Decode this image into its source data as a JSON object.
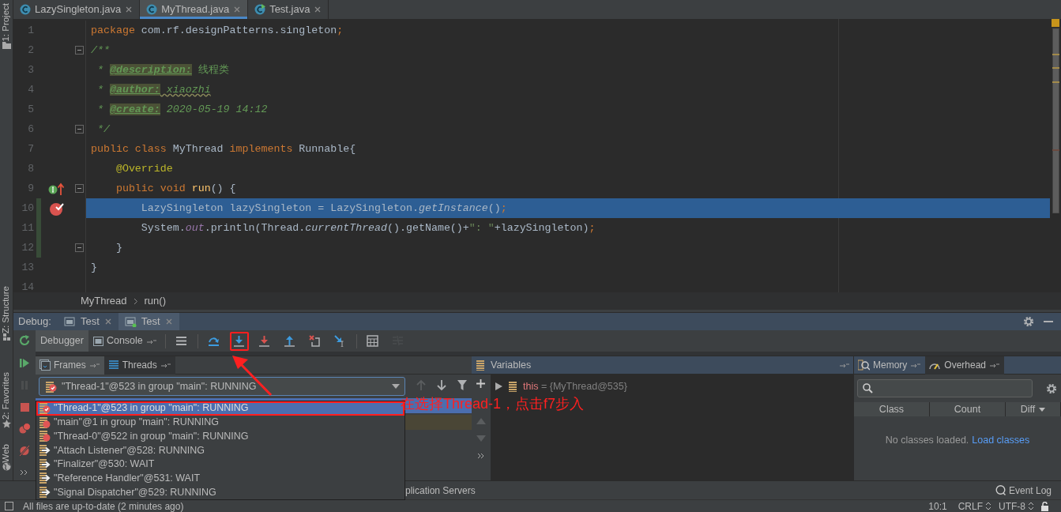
{
  "editor_tabs": [
    {
      "label": "LazySingleton.java",
      "kind": "class",
      "selected": false
    },
    {
      "label": "MyThread.java",
      "kind": "class",
      "selected": true
    },
    {
      "label": "Test.java",
      "kind": "runnable",
      "selected": false
    }
  ],
  "side_tools": [
    "1: Project",
    "Z: Structure",
    "2: Favorites",
    "Web"
  ],
  "code_lines": [
    {
      "number": "1",
      "fold": false,
      "changed": false,
      "override_marker": false,
      "breakpoint": false,
      "selected": false,
      "tokens": [
        {
          "kind": "keyword",
          "text": "package "
        },
        {
          "kind": "plain",
          "text": "com.rf.designPatterns.singleton"
        },
        {
          "kind": "keyword",
          "text": ";"
        }
      ]
    },
    {
      "number": "2",
      "fold": true,
      "changed": false,
      "override_marker": false,
      "breakpoint": false,
      "selected": false,
      "tokens": [
        {
          "kind": "doc",
          "text": "/**"
        }
      ]
    },
    {
      "number": "3",
      "fold": false,
      "changed": false,
      "override_marker": false,
      "breakpoint": false,
      "selected": false,
      "tokens": [
        {
          "kind": "doc",
          "text": " * "
        },
        {
          "kind": "tag",
          "text": "@description:"
        },
        {
          "kind": "docplain",
          "text": " 线程类"
        }
      ]
    },
    {
      "number": "4",
      "fold": false,
      "changed": false,
      "override_marker": false,
      "breakpoint": false,
      "selected": false,
      "tokens": [
        {
          "kind": "doc",
          "text": " * "
        },
        {
          "kind": "tag",
          "text": "@author:"
        },
        {
          "kind": "docvalue",
          "text": " xiaozhi"
        }
      ]
    },
    {
      "number": "5",
      "fold": false,
      "changed": false,
      "override_marker": false,
      "breakpoint": false,
      "selected": false,
      "tokens": [
        {
          "kind": "doc",
          "text": " * "
        },
        {
          "kind": "tag",
          "text": "@create:"
        },
        {
          "kind": "doc",
          "text": " 2020-05-19 14:12"
        }
      ]
    },
    {
      "number": "6",
      "fold": true,
      "changed": false,
      "override_marker": false,
      "breakpoint": false,
      "selected": false,
      "tokens": [
        {
          "kind": "doc",
          "text": " */"
        }
      ]
    },
    {
      "number": "7",
      "fold": false,
      "changed": false,
      "override_marker": false,
      "breakpoint": false,
      "selected": false,
      "tokens": [
        {
          "kind": "keyword",
          "text": "public class "
        },
        {
          "kind": "plain",
          "text": "MyThread "
        },
        {
          "kind": "keyword",
          "text": "implements "
        },
        {
          "kind": "plain",
          "text": "Runnable{"
        }
      ]
    },
    {
      "number": "8",
      "fold": false,
      "changed": false,
      "override_marker": false,
      "breakpoint": false,
      "selected": false,
      "tokens": [
        {
          "kind": "annotation",
          "text": "    @Override"
        }
      ]
    },
    {
      "number": "9",
      "fold": true,
      "changed": false,
      "override_marker": true,
      "breakpoint": false,
      "selected": false,
      "tokens": [
        {
          "kind": "keyword",
          "text": "    public void "
        },
        {
          "kind": "method",
          "text": "run"
        },
        {
          "kind": "plain",
          "text": "() {"
        }
      ]
    },
    {
      "number": "10",
      "fold": false,
      "changed": true,
      "override_marker": false,
      "breakpoint": true,
      "selected": true,
      "tokens": [
        {
          "kind": "plain",
          "text": "        LazySingleton lazySingleton = LazySingleton."
        },
        {
          "kind": "static",
          "text": "getInstance"
        },
        {
          "kind": "plain",
          "text": "()"
        },
        {
          "kind": "keyword",
          "text": ";"
        }
      ]
    },
    {
      "number": "11",
      "fold": false,
      "changed": true,
      "override_marker": false,
      "breakpoint": false,
      "selected": false,
      "tokens": [
        {
          "kind": "plain",
          "text": "        System."
        },
        {
          "kind": "field",
          "text": "out"
        },
        {
          "kind": "plain",
          "text": ".println(Thread."
        },
        {
          "kind": "static",
          "text": "currentThread"
        },
        {
          "kind": "plain",
          "text": "().getName()+"
        },
        {
          "kind": "string",
          "text": "\": \""
        },
        {
          "kind": "plain",
          "text": "+lazySingleton)"
        },
        {
          "kind": "keyword",
          "text": ";"
        }
      ]
    },
    {
      "number": "12",
      "fold": true,
      "changed": true,
      "override_marker": false,
      "breakpoint": false,
      "selected": false,
      "tokens": [
        {
          "kind": "plain",
          "text": "    }"
        }
      ]
    },
    {
      "number": "13",
      "fold": false,
      "changed": false,
      "override_marker": false,
      "breakpoint": false,
      "selected": false,
      "tokens": [
        {
          "kind": "plain",
          "text": "}"
        }
      ]
    },
    {
      "number": "14",
      "fold": false,
      "changed": false,
      "override_marker": false,
      "breakpoint": false,
      "selected": false
    }
  ],
  "breadcrumb": [
    "MyThread",
    "run()"
  ],
  "debug": {
    "title": "Debug:",
    "sessions": [
      {
        "label": "Test",
        "running": false,
        "selected": false
      },
      {
        "label": "Test",
        "running": true,
        "selected": true
      }
    ],
    "side_toolbar": [
      {
        "kind": "rerun",
        "disabled": false
      },
      {
        "kind": "resume",
        "disabled": false
      },
      {
        "kind": "pause",
        "disabled": true
      },
      {
        "kind": "stop",
        "disabled": false
      },
      {
        "kind": "view-breakpoints",
        "disabled": false
      },
      {
        "kind": "mute-breakpoints",
        "disabled": false
      },
      {
        "kind": "more",
        "disabled": false
      }
    ],
    "tabs": [
      {
        "label": "Debugger",
        "selected": true
      },
      {
        "label": "Console",
        "selected": false
      }
    ],
    "toolbar": [
      {
        "kind": "menu",
        "disabled": false,
        "annotated": false
      },
      {
        "kind": "separator"
      },
      {
        "kind": "step-over",
        "disabled": false,
        "annotated": false
      },
      {
        "kind": "step-into",
        "disabled": false,
        "annotated": true
      },
      {
        "kind": "force-step-into",
        "disabled": false,
        "annotated": false
      },
      {
        "kind": "step-out",
        "disabled": false,
        "annotated": false
      },
      {
        "kind": "drop-frame",
        "disabled": false,
        "annotated": false
      },
      {
        "kind": "run-to-cursor",
        "disabled": false,
        "annotated": false
      },
      {
        "kind": "separator"
      },
      {
        "kind": "evaluate",
        "disabled": false,
        "annotated": false
      },
      {
        "kind": "trace",
        "disabled": true,
        "annotated": false
      }
    ],
    "frames_tabs": [
      {
        "label": "Frames",
        "kind": "frames",
        "selected": true
      },
      {
        "label": "Threads",
        "kind": "threads",
        "selected": false
      }
    ],
    "thread_selector": {
      "value": "\"Thread-1\"@523 in group \"main\": RUNNING"
    },
    "frames": [
      {
        "selected": true,
        "library": false
      },
      {
        "selected": false,
        "library": true
      }
    ],
    "variables": {
      "title": "Variables",
      "items": [
        {
          "name": "this",
          "value": "= {MyThread@535}",
          "expanded": false
        }
      ]
    },
    "memory_tabs": [
      {
        "label": "Memory",
        "kind": "memory",
        "selected": false
      },
      {
        "label": "Overhead",
        "kind": "overhead",
        "selected": true
      }
    ],
    "memory": {
      "columns": [
        "Class",
        "Count",
        "Diff"
      ],
      "message": "No classes loaded.",
      "link": "Load classes"
    }
  },
  "thread_popup": [
    {
      "label": "\"Thread-1\"@523 in group \"main\": RUNNING",
      "kind": "suspended",
      "selected": true,
      "annotated": true
    },
    {
      "label": "\"main\"@1 in group \"main\": RUNNING",
      "kind": "breakpoint",
      "selected": false,
      "annotated": false
    },
    {
      "label": "\"Thread-0\"@522 in group \"main\": RUNNING",
      "kind": "breakpoint",
      "selected": false,
      "annotated": false
    },
    {
      "label": "\"Attach Listener\"@528: RUNNING",
      "kind": "running",
      "selected": false,
      "annotated": false
    },
    {
      "label": "\"Finalizer\"@530: WAIT",
      "kind": "running",
      "selected": false,
      "annotated": false
    },
    {
      "label": "\"Reference Handler\"@531: WAIT",
      "kind": "running",
      "selected": false,
      "annotated": false
    },
    {
      "label": "\"Signal Dispatcher\"@529: RUNNING",
      "kind": "running",
      "selected": false,
      "annotated": false
    }
  ],
  "annotation": {
    "text": "在选择Thread-1，点击f7步入"
  },
  "tool_bar": {
    "items": [
      "plication Servers"
    ],
    "event_log": "Event Log"
  },
  "status_bar": {
    "message": "All files are up-to-date (2 minutes ago)",
    "position": "10:1",
    "line_separator": "CRLF",
    "encoding": "UTF-8"
  }
}
